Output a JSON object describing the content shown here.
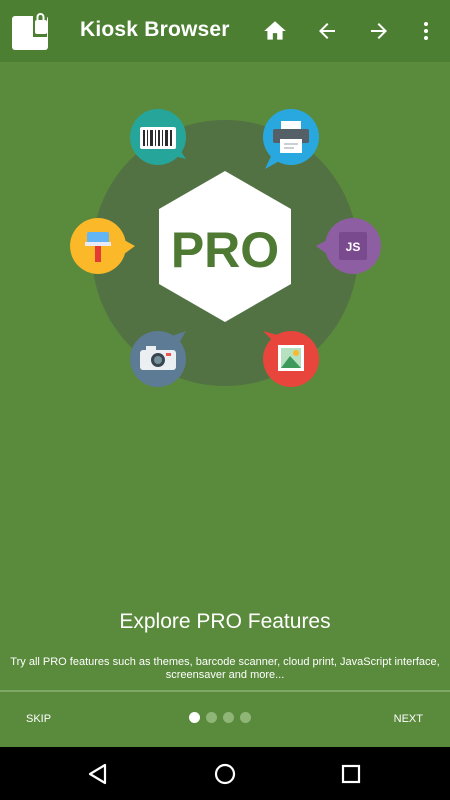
{
  "appbar": {
    "title": "Kiosk Browser",
    "icons": [
      "home-icon",
      "back-arrow-icon",
      "forward-arrow-icon",
      "more-vert-icon"
    ]
  },
  "colors": {
    "appbar": "#4d7f33",
    "background": "#5a8a3c",
    "barcode": "#26a69a",
    "print": "#29a8e0",
    "javascript": "#8e5ea2",
    "camera": "#5d7b95",
    "image": "#e8453c",
    "theme": "#fbb829"
  },
  "hero": {
    "badge_text": "PRO",
    "features": [
      "barcode-scanner-icon",
      "cloud-print-icon",
      "javascript-icon",
      "image-icon",
      "camera-icon",
      "theme-brush-icon"
    ],
    "js_label": "JS"
  },
  "onboarding": {
    "headline": "Explore PRO Features",
    "description": "Try all PRO features such as themes, barcode scanner, cloud print, JavaScript interface, screensaver and more...",
    "skip_label": "SKIP",
    "next_label": "NEXT",
    "page_count": 4,
    "current_page": 1
  },
  "navbar": {
    "icons": [
      "nav-back-icon",
      "nav-home-icon",
      "nav-recents-icon"
    ]
  }
}
